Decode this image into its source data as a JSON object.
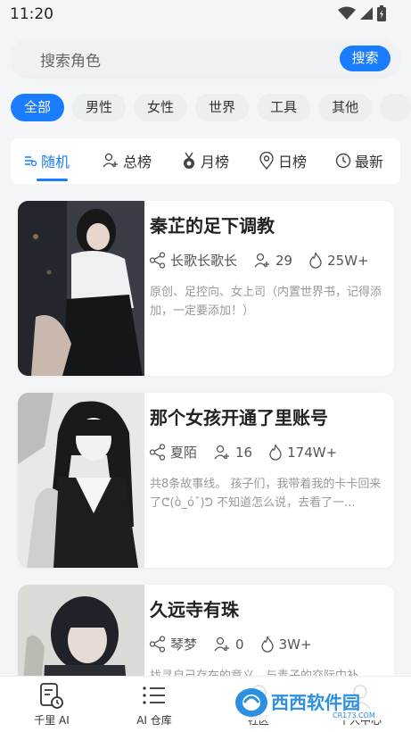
{
  "status": {
    "time": "11:20"
  },
  "search": {
    "placeholder": "搜索角色",
    "button": "搜索"
  },
  "categories": [
    "全部",
    "男性",
    "女性",
    "世界",
    "工具",
    "其他"
  ],
  "tabs": [
    "随机",
    "总榜",
    "月榜",
    "日榜",
    "最新"
  ],
  "cards": [
    {
      "title": "秦芷的足下调教",
      "author": "长歌长歌长",
      "followers": "29",
      "heat": "25W+",
      "desc": "原创、足控向、女上司（内置世界书，记得添加，一定要添加！）"
    },
    {
      "title": "那个女孩开通了里账号",
      "author": "夏陌",
      "followers": "16",
      "heat": "174W+",
      "desc": "共8条故事线。 孩子们，我带着我的卡卡回来了ᕦ(ò_óˇ)ᕤ 不知道怎么说，去看了一..."
    },
    {
      "title": "久远寺有珠",
      "author": "琴梦",
      "followers": "0",
      "heat": "3W+",
      "desc": "找寻自己存在的意义，与青子的交际中补..."
    }
  ],
  "nav": [
    {
      "label": "千里 AI",
      "icon": "document-clock-icon"
    },
    {
      "label": "AI 仓库",
      "icon": "list-icon"
    },
    {
      "label": "社区",
      "icon": "community-icon"
    },
    {
      "label": "个人中心",
      "icon": "profile-icon"
    }
  ],
  "watermark": {
    "text": "西西软件园",
    "url_text": "CR173.COM"
  },
  "colors": {
    "accent": "#1a7cff",
    "background": "#f4f5f7"
  }
}
